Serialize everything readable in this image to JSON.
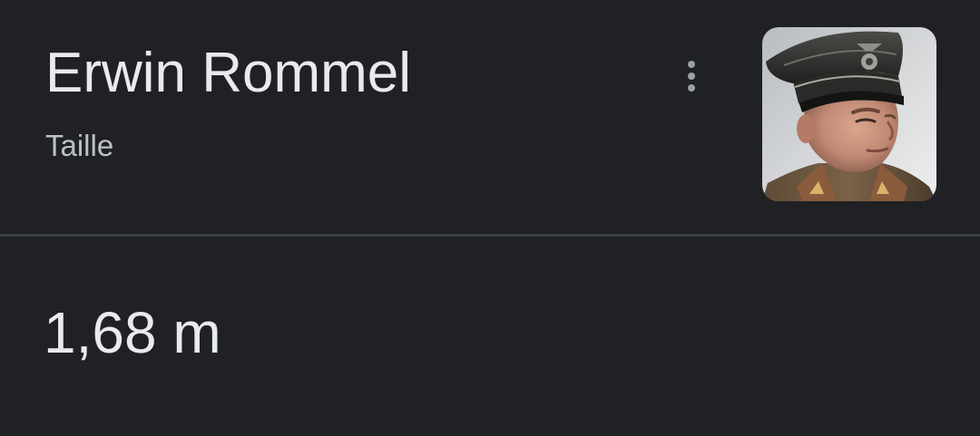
{
  "card": {
    "title": "Erwin Rommel",
    "subtitle": "Taille",
    "value": "1,68 m",
    "more_icon": "more-vertical-icon",
    "thumbnail_icon": "portrait-photo"
  },
  "colors": {
    "background": "#202124",
    "title_text": "#e8eaed",
    "subtitle_text": "#bdc1c6",
    "icon": "#9aa0a6",
    "divider": "#3c4043"
  }
}
